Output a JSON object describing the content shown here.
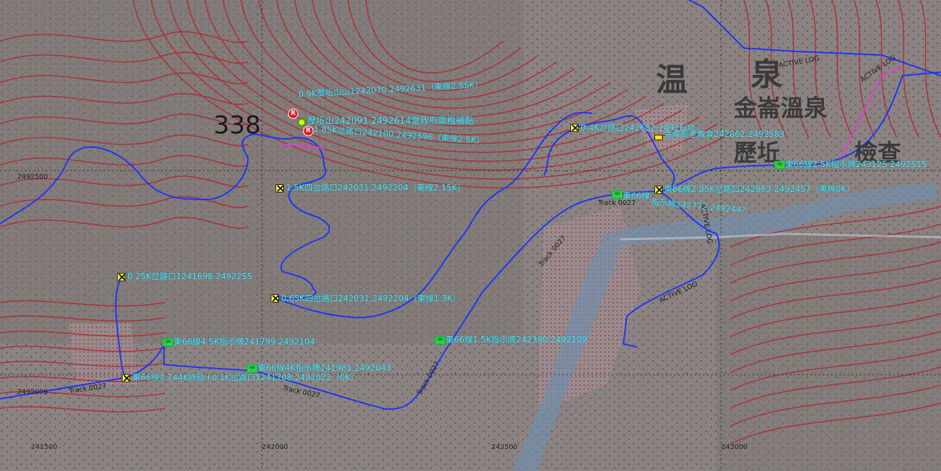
{
  "map": {
    "elevation_label": "338",
    "place_names": [
      "温",
      "泉",
      "金崙溫泉",
      "歷坵",
      "檢查"
    ],
    "grid_labels_x": [
      "241500",
      "242000",
      "242500",
      "243000"
    ],
    "grid_labels_y": [
      "2492500",
      "2492000"
    ],
    "track_labels": [
      "Track 0027",
      "Track 0027",
      "Track 0027",
      "Track 0027",
      "Track 0027"
    ],
    "log_labels": [
      "ACTIVE LOG",
      "ACTIVE LOG",
      "ACTIVE LOG",
      "ACTIVE LOG"
    ],
    "colors": {
      "background": "#8a7d7f",
      "contour": "#b02a30",
      "track": "#1a33ff",
      "highlight_track": "#e63ad8",
      "waypoint_text": "#4ff0ff"
    },
    "waypoints": [
      {
        "icon": "R",
        "label": "0.9K歷坵山山1242070.2492631（東線2.55K）"
      },
      {
        "icon": "summit",
        "label": "歷坵山242091.2492614當政府圖根補點"
      },
      {
        "icon": "R",
        "label": "1.85K岔路口242100.2492596（東線2.5K）"
      },
      {
        "icon": "X",
        "label": "0.4K岔路口242682.2492600"
      },
      {
        "icon": "church",
        "label": "金崙長老教會242862.2492583"
      },
      {
        "icon": "MM",
        "label": "東66線2.5K指示牌243125.2492515"
      },
      {
        "icon": "X",
        "label": "1.5K四岔路口242031.2492204（東線2.15K）"
      },
      {
        "icon": "MM",
        "label": "東66線"
      },
      {
        "icon": "X",
        "label": "東66線2.85K岔路口242863.2492457（東線0K）"
      },
      {
        "icon": "none",
        "label": "指示牌242772.249244?"
      },
      {
        "icon": "X",
        "label": "0.25K岔路口1241698.2492255"
      },
      {
        "icon": "X",
        "label": "0.65K四岔路口242031.2492204（東線1.3K）"
      },
      {
        "icon": "MM",
        "label": "東66線4.5K指示牌241799.2492104"
      },
      {
        "icon": "MM",
        "label": "東66線1.5K指示牌242390.2492109"
      },
      {
        "icon": "MM",
        "label": "東66線4K指示牌241981.2492043"
      },
      {
        "icon": "X",
        "label": "東66線4.744K終點+0.1K岔路口1241708.2492022（0K）"
      }
    ]
  }
}
